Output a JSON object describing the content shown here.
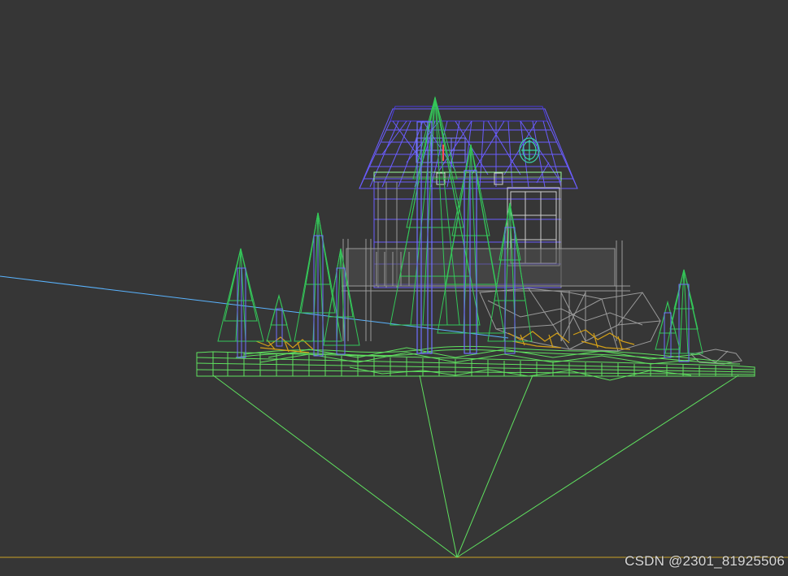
{
  "viewport": {
    "background": "#363636",
    "view_mode": "wireframe",
    "colors": {
      "terrain": "#5fe05f",
      "trees": "#34c759",
      "trunks": "#6e6eff",
      "house": "#6a5cff",
      "rocks": "#9a9a9a",
      "grass_tufts": "#d4a017",
      "grid_line": "#c9a227",
      "guide_line": "#5ab4ff",
      "window_frame": "#cfcfcf"
    }
  },
  "watermark": "CSDN @2301_81925506"
}
